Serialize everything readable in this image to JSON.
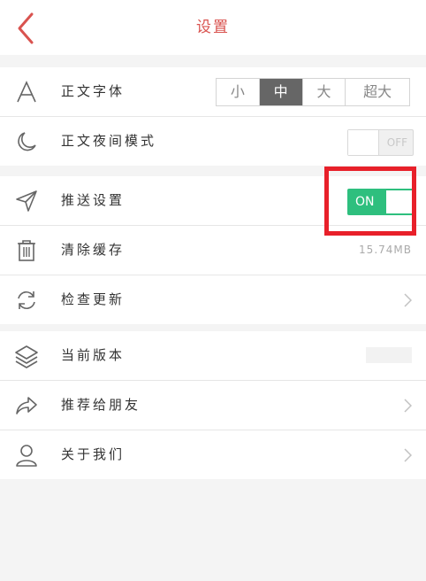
{
  "header": {
    "title": "设置",
    "back_icon": "chevron-left-icon",
    "accent_color": "#d9534f"
  },
  "settings": {
    "font": {
      "label": "正文字体",
      "icon": "font-a-icon",
      "options": [
        "小",
        "中",
        "大",
        "超大"
      ],
      "selected": "中"
    },
    "night_mode": {
      "label": "正文夜间模式",
      "icon": "moon-icon",
      "toggle_text": "OFF",
      "state": "off"
    },
    "push": {
      "label": "推送设置",
      "icon": "paper-plane-icon",
      "toggle_text": "ON",
      "state": "on",
      "toggle_color": "#2ebf7e"
    },
    "cache": {
      "label": "清除缓存",
      "icon": "trash-icon",
      "value": "15.74MB"
    },
    "update": {
      "label": "检查更新",
      "icon": "refresh-icon"
    },
    "version": {
      "label": "当前版本",
      "icon": "layers-icon"
    },
    "recommend": {
      "label": "推荐给朋友",
      "icon": "share-icon"
    },
    "about": {
      "label": "关于我们",
      "icon": "user-icon"
    }
  },
  "annotation": {
    "highlight_color": "#e8202a"
  }
}
